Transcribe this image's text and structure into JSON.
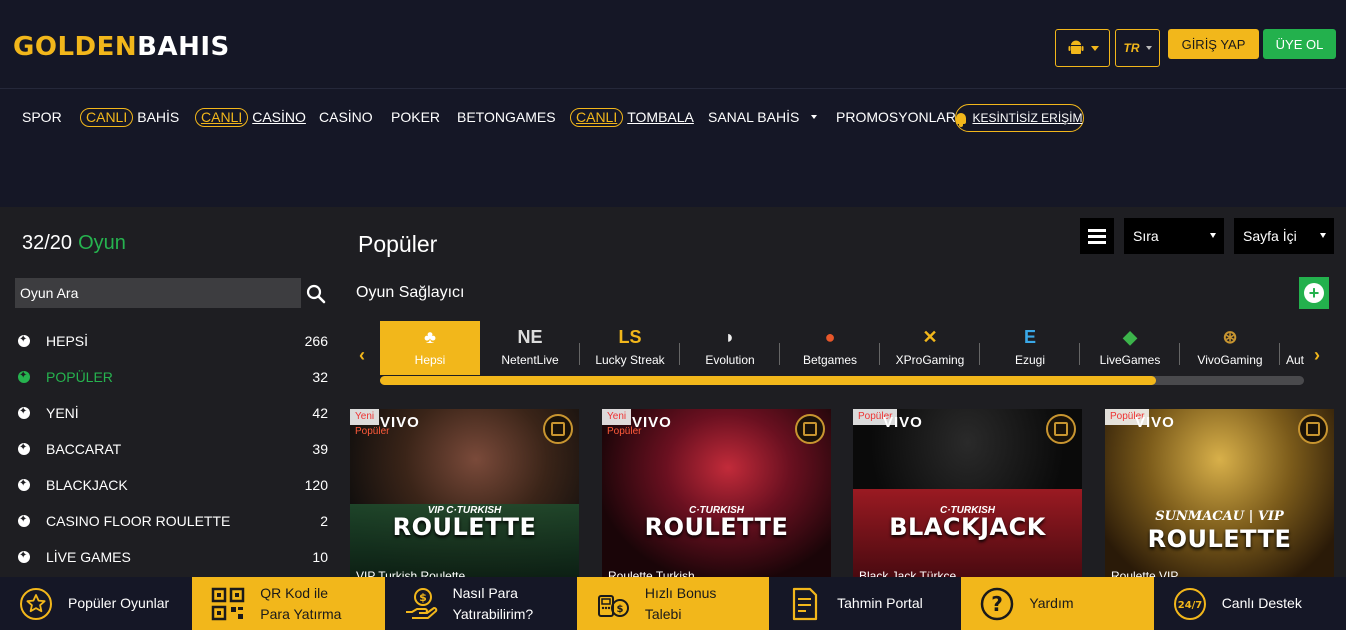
{
  "header": {
    "logo_left": "GOLDEN",
    "logo_right": "BAHIS",
    "lang": "TR",
    "login_label": "GİRİŞ YAP",
    "register_label": "ÜYE OL"
  },
  "nav": {
    "spor": "SPOR",
    "canli_bahis_pill": "CANLI",
    "canli_bahis_label": "BAHİS",
    "canli_casino_pill": "CANLI",
    "canli_casino_label": "CASİNO",
    "casino": "CASİNO",
    "poker": "POKER",
    "betongames": "BETONGAMES",
    "canli_tombala_pill": "CANLI",
    "canli_tombala_label": "TOMBALA",
    "sanal_bahis": "SANAL BAHİS",
    "promosyonlar": "PROMOSYONLAR",
    "access": "KESİNTİSİZ ERİŞİM"
  },
  "sidebar": {
    "count": "32/20",
    "count_label": "Oyun",
    "search_placeholder": "Oyun Ara",
    "categories": [
      {
        "label": "HEPSİ",
        "count": "266"
      },
      {
        "label": "POPÜLER",
        "count": "32"
      },
      {
        "label": "YENİ",
        "count": "42"
      },
      {
        "label": "BACCARAT",
        "count": "39"
      },
      {
        "label": "BLACKJACK",
        "count": "120"
      },
      {
        "label": "CASINO FLOOR ROULETTE",
        "count": "2"
      },
      {
        "label": "LİVE GAMES",
        "count": "10"
      }
    ]
  },
  "main": {
    "title": "Popüler",
    "sort_label": "Sıra",
    "page_label": "Sayfa İçi",
    "providers_title": "Oyun Sağlayıcı",
    "providers": [
      {
        "label": "Hepsi",
        "icon": "♣"
      },
      {
        "label": "NetentLive",
        "icon": "NE"
      },
      {
        "label": "Lucky Streak",
        "icon": "LS"
      },
      {
        "label": "Evolution",
        "icon": "◗"
      },
      {
        "label": "Betgames",
        "icon": "●"
      },
      {
        "label": "XProGaming",
        "icon": "✕"
      },
      {
        "label": "Ezugi",
        "icon": "E"
      },
      {
        "label": "LiveGames",
        "icon": "◆"
      },
      {
        "label": "VivoGaming",
        "icon": "⊛"
      },
      {
        "label": "Aut",
        "icon": ""
      }
    ],
    "scroll_progress": 0.84,
    "games": [
      {
        "tag1": "Yeni",
        "tag2": "Popüler",
        "brand": "VIVO",
        "subtitle": "VIP  C·TURKISH",
        "title": "ROULETTE",
        "name": "VIP Turkish Roulette"
      },
      {
        "tag1": "Yeni",
        "tag2": "Popüler",
        "brand": "VIVO",
        "subtitle": "C·TURKISH",
        "title": "ROULETTE",
        "name": "Roulette Turkish"
      },
      {
        "tag1": "Popüler",
        "tag2": "",
        "brand": "VIVO",
        "subtitle": "C·TURKISH",
        "title": "BLACKJACK",
        "name": "Black Jack Türkçe"
      },
      {
        "tag1": "Popüler",
        "tag2": "",
        "brand": "VIVO",
        "subtitle": "SUNMACAU | VIP",
        "title": "ROULETTE",
        "name": "Roulette VIP"
      }
    ]
  },
  "bottom": [
    {
      "label": "Popüler Oyunlar",
      "icon": "star-icon"
    },
    {
      "label": "QR Kod ile Para Yatırma",
      "icon": "qr-code-icon"
    },
    {
      "label": "Nasıl Para Yatırabilirim?",
      "icon": "money-hand-icon"
    },
    {
      "label": "Hızlı Bonus Talebi",
      "icon": "bonus-icon"
    },
    {
      "label": "Tahmin Portal",
      "icon": "document-icon"
    },
    {
      "label": "Yardım",
      "icon": "help-icon"
    },
    {
      "label": "Canlı Destek",
      "icon": "support-24-7-icon"
    }
  ]
}
